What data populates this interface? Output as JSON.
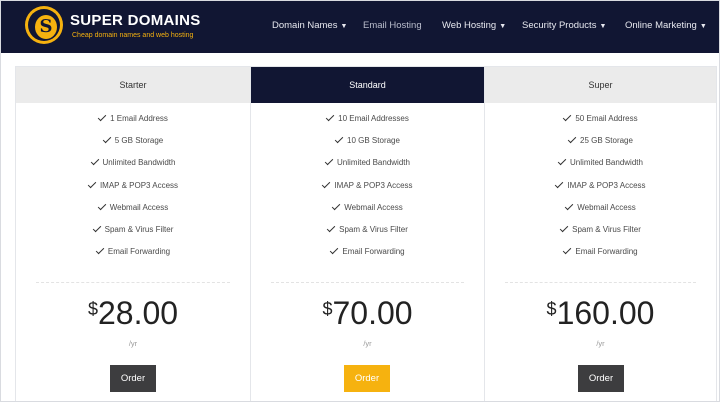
{
  "brand": {
    "name": "SUPER DOMAINS",
    "tagline": "Cheap domain names and web hosting",
    "logo_letter": "S",
    "accent_color": "#f6b20f",
    "header_color": "#111633"
  },
  "nav": [
    {
      "label": "Domain Names",
      "has_caret": true
    },
    {
      "label": "Email Hosting",
      "has_caret": false
    },
    {
      "label": "Web Hosting",
      "has_caret": true
    },
    {
      "label": "Security Products",
      "has_caret": true
    },
    {
      "label": "Online Marketing",
      "has_caret": true
    }
  ],
  "icons": {
    "check": "check-icon",
    "caret": "chevron-down-icon"
  },
  "plans": [
    {
      "name": "Starter",
      "features": [
        "1 Email Address",
        "5 GB Storage",
        "Unlimited Bandwidth",
        "IMAP & POP3 Access",
        "Webmail Access",
        "Spam & Virus Filter",
        "Email Forwarding"
      ],
      "currency": "$",
      "price": "28.00",
      "period": "/yr",
      "button": "Order"
    },
    {
      "name": "Standard",
      "features": [
        "10 Email Addresses",
        "10 GB Storage",
        "Unlimited Bandwidth",
        "IMAP & POP3 Access",
        "Webmail Access",
        "Spam & Virus Filter",
        "Email Forwarding"
      ],
      "currency": "$",
      "price": "70.00",
      "period": "/yr",
      "button": "Order"
    },
    {
      "name": "Super",
      "features": [
        "50 Email Address",
        "25 GB Storage",
        "Unlimited Bandwidth",
        "IMAP & POP3 Access",
        "Webmail Access",
        "Spam & Virus Filter",
        "Email Forwarding"
      ],
      "currency": "$",
      "price": "160.00",
      "period": "/yr",
      "button": "Order"
    }
  ]
}
